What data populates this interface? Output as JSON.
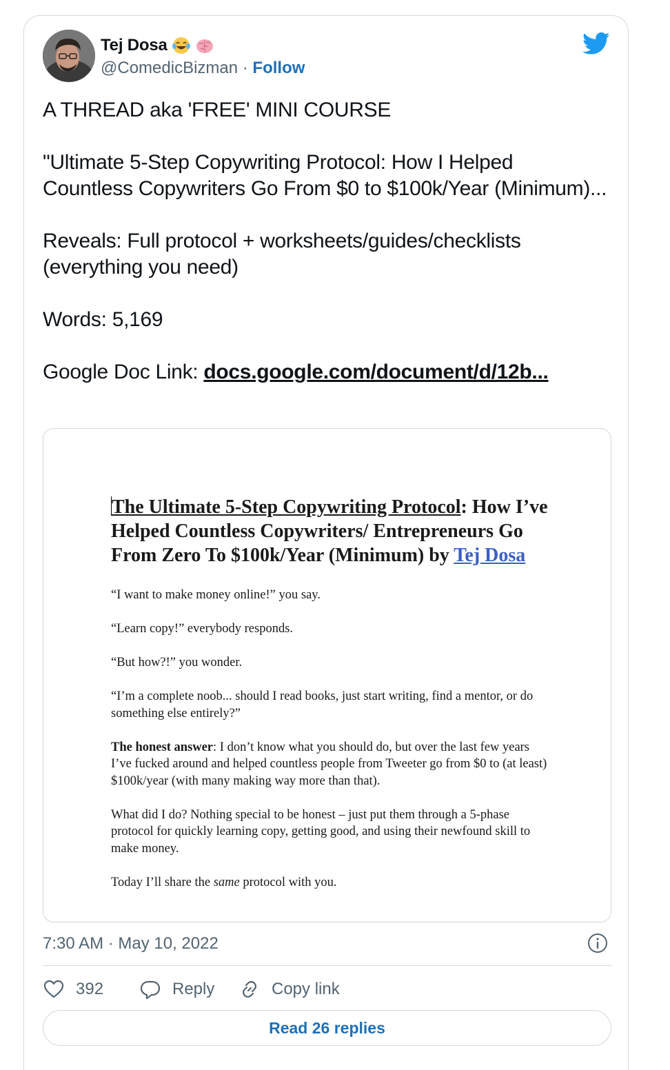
{
  "author": {
    "name": "Tej Dosa",
    "handle": "@ComedicBizman",
    "separator": " · ",
    "follow_label": "Follow"
  },
  "tweet": {
    "paragraphs": [
      "A THREAD aka 'FREE' MINI COURSE",
      "\"Ultimate 5-Step Copywriting Protocol: How I Helped Countless Copywriters Go From $0 to $100k/Year (Minimum)...",
      "Reveals: Full protocol + worksheets/guides/checklists (everything you need)",
      "Words: 5,169"
    ],
    "link_prefix": "Google Doc Link: ",
    "link_text": "docs.google.com/document/d/12b..."
  },
  "doc_preview": {
    "title_underlined": "The Ultimate 5-Step Copywriting Protocol",
    "title_colon": ":",
    "title_rest": "How I’ve Helped Countless Copywriters/ Entrepreneurs Go From Zero To $100k/Year (Minimum) by ",
    "title_author": "Tej Dosa",
    "p1": "“I want to make money online!” you say.",
    "p2": "“Learn copy!” everybody responds.",
    "p3": "“But how?!” you wonder.",
    "p4": "“I’m a complete noob... should I read books, just start writing, find a mentor, or do something else entirely?”",
    "p5_bold": "The honest answer",
    "p5_rest": ": I don’t know what you should do, but over the last few years I’ve fucked around and helped countless people from Tweeter go from $0 to (at least) $100k/year (with many making way more than that).",
    "p6": "What did I do? Nothing special to be honest – just put them through a 5-phase protocol for quickly learning copy, getting good, and using their newfound skill to make money.",
    "p7_before": "Today I’ll share the ",
    "p7_italic": "same",
    "p7_after": " protocol with you."
  },
  "meta": {
    "timestamp": "7:30 AM · May 10, 2022"
  },
  "actions": {
    "like_count": "392",
    "reply_label": "Reply",
    "copy_label": "Copy link"
  },
  "read_replies_label": "Read 26 replies",
  "icons": {
    "brand": "twitter-bird-icon",
    "emoji_1": "tears-of-joy-emoji",
    "emoji_2": "brain-emoji",
    "info": "info-icon",
    "like": "heart-icon",
    "reply": "reply-bubble-icon",
    "copy": "link-icon"
  },
  "colors": {
    "brand": "#1d9bf0",
    "link": "#1d70b8",
    "muted": "#536471",
    "border": "#cfd9de"
  }
}
